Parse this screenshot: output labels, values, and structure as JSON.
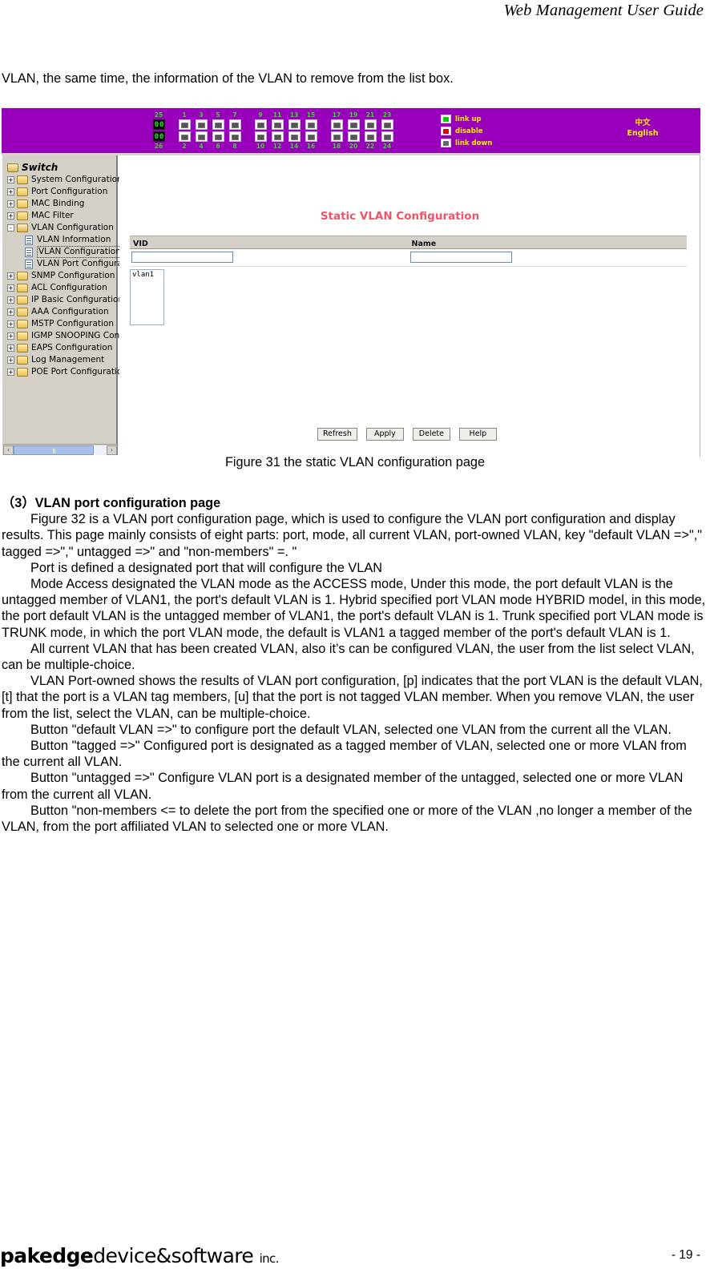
{
  "running_head": "Web Management User Guide",
  "lead_paragraph": "VLAN, the same time, the information of the VLAN to remove from the list box.",
  "figure_caption": "Figure 31 the static VLAN configuration page",
  "screenshot": {
    "banner": {
      "background_color": "#9900bb",
      "sfp_ports": [
        {
          "top_label": "25",
          "bottom_label": "26",
          "type": "sfp"
        }
      ],
      "port_groups": [
        {
          "top": [
            "1",
            "3",
            "5",
            "7"
          ],
          "bottom": [
            "2",
            "4",
            "6",
            "8"
          ]
        },
        {
          "top": [
            "9",
            "11",
            "13",
            "15"
          ],
          "bottom": [
            "10",
            "12",
            "14",
            "16"
          ]
        },
        {
          "top": [
            "17",
            "19",
            "21",
            "23"
          ],
          "bottom": [
            "18",
            "20",
            "22",
            "24"
          ]
        }
      ],
      "legend": [
        {
          "icon": "port-up-icon",
          "label": "link up",
          "color": "#00cc00"
        },
        {
          "icon": "port-disable-icon",
          "label": "disable",
          "color": "#dd0000"
        },
        {
          "icon": "port-down-icon",
          "label": "link down",
          "color": "#666666"
        }
      ],
      "language_links": [
        "中文",
        "English"
      ],
      "link_text_color": "#ffee00"
    },
    "sidebar": {
      "root_label": "Switch",
      "items": [
        {
          "label": "System Configuration",
          "type": "folder",
          "expander": "+",
          "level": 1
        },
        {
          "label": "Port Configuration",
          "type": "folder",
          "expander": "+",
          "level": 1
        },
        {
          "label": "MAC Binding",
          "type": "folder",
          "expander": "+",
          "level": 1
        },
        {
          "label": "MAC Filter",
          "type": "folder",
          "expander": "+",
          "level": 1
        },
        {
          "label": "VLAN Configuration",
          "type": "folder-open",
          "expander": "-",
          "level": 1
        },
        {
          "label": "VLAN Information",
          "type": "page",
          "expander": "",
          "level": 2
        },
        {
          "label": "VLAN Configuration",
          "type": "page",
          "expander": "",
          "level": 2,
          "selected": true
        },
        {
          "label": "VLAN Port Configuration",
          "type": "page",
          "expander": "",
          "level": 2
        },
        {
          "label": "SNMP Configuration",
          "type": "folder",
          "expander": "+",
          "level": 1
        },
        {
          "label": "ACL Configuration",
          "type": "folder",
          "expander": "+",
          "level": 1
        },
        {
          "label": "IP Basic Configuration",
          "type": "folder",
          "expander": "+",
          "level": 1
        },
        {
          "label": "AAA Configuration",
          "type": "folder",
          "expander": "+",
          "level": 1
        },
        {
          "label": "MSTP Configuration",
          "type": "folder",
          "expander": "+",
          "level": 1
        },
        {
          "label": "IGMP SNOOPING Configura",
          "type": "folder",
          "expander": "+",
          "level": 1
        },
        {
          "label": "EAPS Configuration",
          "type": "folder",
          "expander": "+",
          "level": 1
        },
        {
          "label": "Log Management",
          "type": "folder",
          "expander": "+",
          "level": 1
        },
        {
          "label": "POE Port Configuration",
          "type": "folder",
          "expander": "+",
          "level": 1
        }
      ],
      "scroll_left_arrow": "‹",
      "scroll_right_arrow": "›"
    },
    "content": {
      "title": "Static VLAN Configuration",
      "title_color": "#ee5566",
      "columns": [
        {
          "header": "VID",
          "value": "",
          "placeholder": ""
        },
        {
          "header": "Name",
          "value": "",
          "placeholder": ""
        }
      ],
      "vlan_list": [
        "vlan1"
      ],
      "buttons": [
        {
          "label": "Refresh"
        },
        {
          "label": "Apply"
        },
        {
          "label": "Delete"
        },
        {
          "label": "Help"
        }
      ]
    }
  },
  "section": {
    "heading": "（3）VLAN port configuration page",
    "paragraphs": [
      "Figure 32 is a VLAN port configuration page, which is used to configure the VLAN port configuration and display results. This page mainly consists of eight parts: port, mode, all current VLAN, port-owned VLAN, key \"default VLAN =>\",\" tagged =>\",\" untagged =>\" and \"non-members\" =. \"",
      "Port is defined a designated port that will configure the VLAN",
      "Mode Access designated the VLAN mode as the ACCESS mode, Under this mode, the port default VLAN is the untagged member of VLAN1, the port's default VLAN is 1. Hybrid specified port VLAN mode HYBRID model, in this mode, the port default VLAN is the untagged member of VLAN1, the port's default VLAN is 1. Trunk specified port VLAN mode is TRUNK mode, in which the port VLAN mode, the default is VLAN1 a tagged member of the port's default VLAN is 1.",
      "All current VLAN that has been created VLAN, also it’s can be configured VLAN, the user from the list select VLAN, can be multiple-choice.",
      "VLAN Port-owned shows the results of VLAN port configuration, [p] indicates that the port VLAN is the default VLAN, [t] that the port is a VLAN tag members, [u] that the port is not tagged VLAN member. When you remove VLAN, the user from the list, select the VLAN, can be multiple-choice.",
      "Button \"default VLAN =>\" to configure port the default VLAN, selected one VLAN from the current all the VLAN.",
      "Button \"tagged =>\" Configured port is designated as a tagged member of VLAN, selected one or more VLAN from the current all VLAN.",
      "Button \"untagged =>\" Configure VLAN port is a designated member of the untagged, selected one or more VLAN from the current all VLAN.",
      "Button \"non-members <= to delete the port from the specified one or more of the VLAN ,no longer a member of the VLAN, from the port affiliated VLAN to selected one or more VLAN."
    ]
  },
  "footer": {
    "logo_bold": "pakedge",
    "logo_regular": "device&software",
    "logo_suffix": "inc.",
    "page_number": "- 19 -"
  }
}
